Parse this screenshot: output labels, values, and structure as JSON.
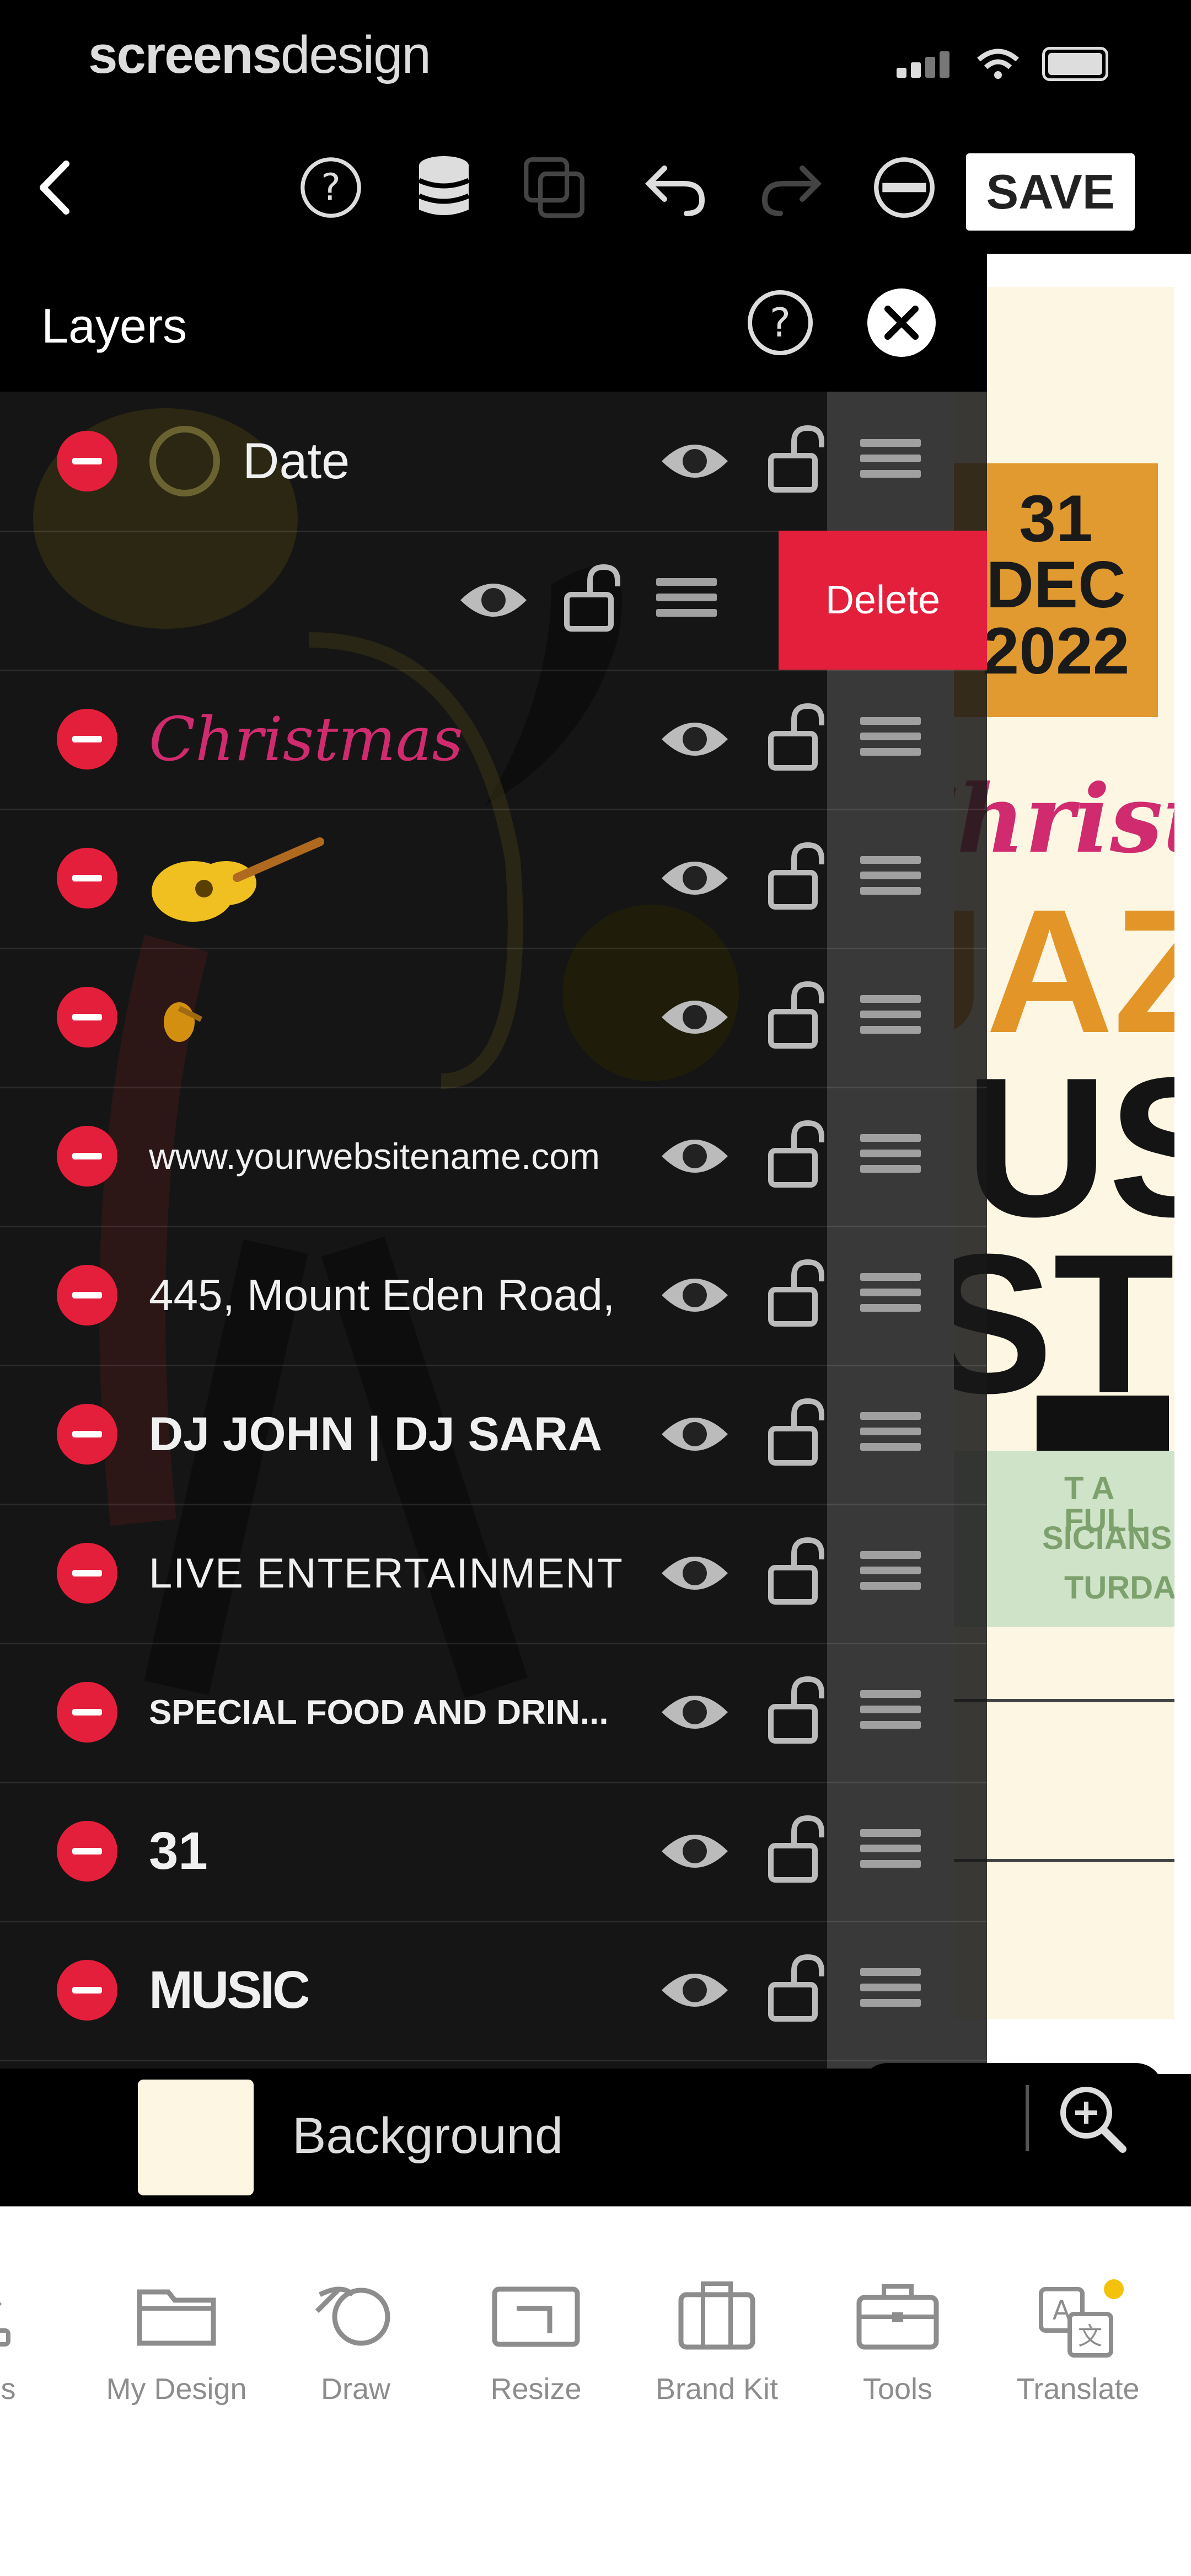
{
  "status_bar": {
    "brand_bold": "screens",
    "brand_light": "design"
  },
  "toolbar": {
    "save_label": "SAVE"
  },
  "layers_panel": {
    "title": "Layers",
    "rows": [
      {
        "label": "Date",
        "kind": "text"
      },
      {
        "label": "",
        "kind": "shape"
      },
      {
        "label": "Christmas",
        "kind": "script-text"
      },
      {
        "label": "guitar",
        "kind": "image"
      },
      {
        "label": "small",
        "kind": "image"
      },
      {
        "label": "www.yourwebsitename.com",
        "kind": "text"
      },
      {
        "label": "445, Mount Eden Road,",
        "kind": "text"
      },
      {
        "label": "DJ JOHN | DJ SARA",
        "kind": "text"
      },
      {
        "label": "LIVE ENTERTAINMENT",
        "kind": "text"
      },
      {
        "label": "SPECIAL FOOD AND DRIN...",
        "kind": "text"
      },
      {
        "label": "31",
        "kind": "text"
      },
      {
        "label": "MUSIC",
        "kind": "text"
      }
    ],
    "swipe_action_label": "Delete",
    "background_label": "Background"
  },
  "poster": {
    "date_day": "31",
    "date_month": "DEC",
    "date_year": "2022",
    "christmas": "Christmas",
    "jazz": "JAZZ",
    "music": "MUSIC",
    "festival": "FESTIVAL",
    "pill_lines": [
      "T A FULL",
      "SICIANS",
      "TURDAY"
    ]
  },
  "bottom_nav": {
    "items": [
      {
        "label": "oads",
        "icon": "upload-icon"
      },
      {
        "label": "My Design",
        "icon": "folder-icon"
      },
      {
        "label": "Draw",
        "icon": "draw-icon"
      },
      {
        "label": "Resize",
        "icon": "resize-icon"
      },
      {
        "label": "Brand Kit",
        "icon": "brand-kit-icon"
      },
      {
        "label": "Tools",
        "icon": "toolbox-icon"
      },
      {
        "label": "Translate",
        "icon": "translate-icon"
      }
    ]
  },
  "colors": {
    "accent_red": "#e41f3b",
    "poster_bg": "#fcf6e3",
    "date_orange": "#e19a30",
    "christmas_pink": "#d02b6e"
  }
}
